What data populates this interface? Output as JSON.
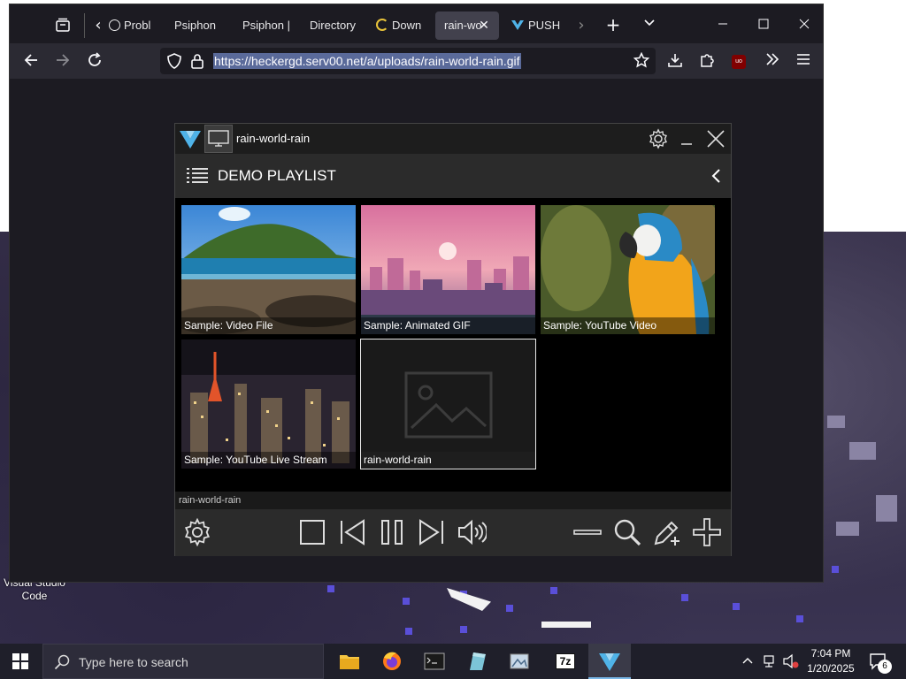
{
  "desktop": {
    "vscode_label": "Visual Studio Code"
  },
  "browser": {
    "tabs": [
      {
        "label": "Probl",
        "active": false
      },
      {
        "label": "Psiphon",
        "active": false
      },
      {
        "label": "Psiphon |",
        "active": false
      },
      {
        "label": "Directory",
        "active": false
      },
      {
        "label": "Down",
        "active": false
      },
      {
        "label": "rain-wo",
        "active": true
      },
      {
        "label": "PUSH",
        "active": false
      }
    ],
    "url": "https://heckergd.serv00.net/a/uploads/rain-world-rain.gif"
  },
  "player": {
    "title": "rain-world-rain",
    "playlist_title": "DEMO PLAYLIST",
    "items": [
      {
        "label": "Sample: Video File"
      },
      {
        "label": "Sample: Animated GIF"
      },
      {
        "label": "Sample: YouTube Video"
      },
      {
        "label": "Sample: YouTube Live Stream"
      },
      {
        "label": "rain-world-rain"
      }
    ],
    "status": "rain-world-rain"
  },
  "taskbar": {
    "search_placeholder": "Type here to search",
    "time": "7:04 PM",
    "date": "1/20/2025",
    "notification_count": "6",
    "zip_label": "7z"
  },
  "colors": {
    "browser_bg": "#1c1b22",
    "tab_active": "#42414d",
    "player_panel": "#2b2b2b",
    "accent_blue": "#4fb3e8",
    "taskbar_bg": "#1f1f2a"
  }
}
